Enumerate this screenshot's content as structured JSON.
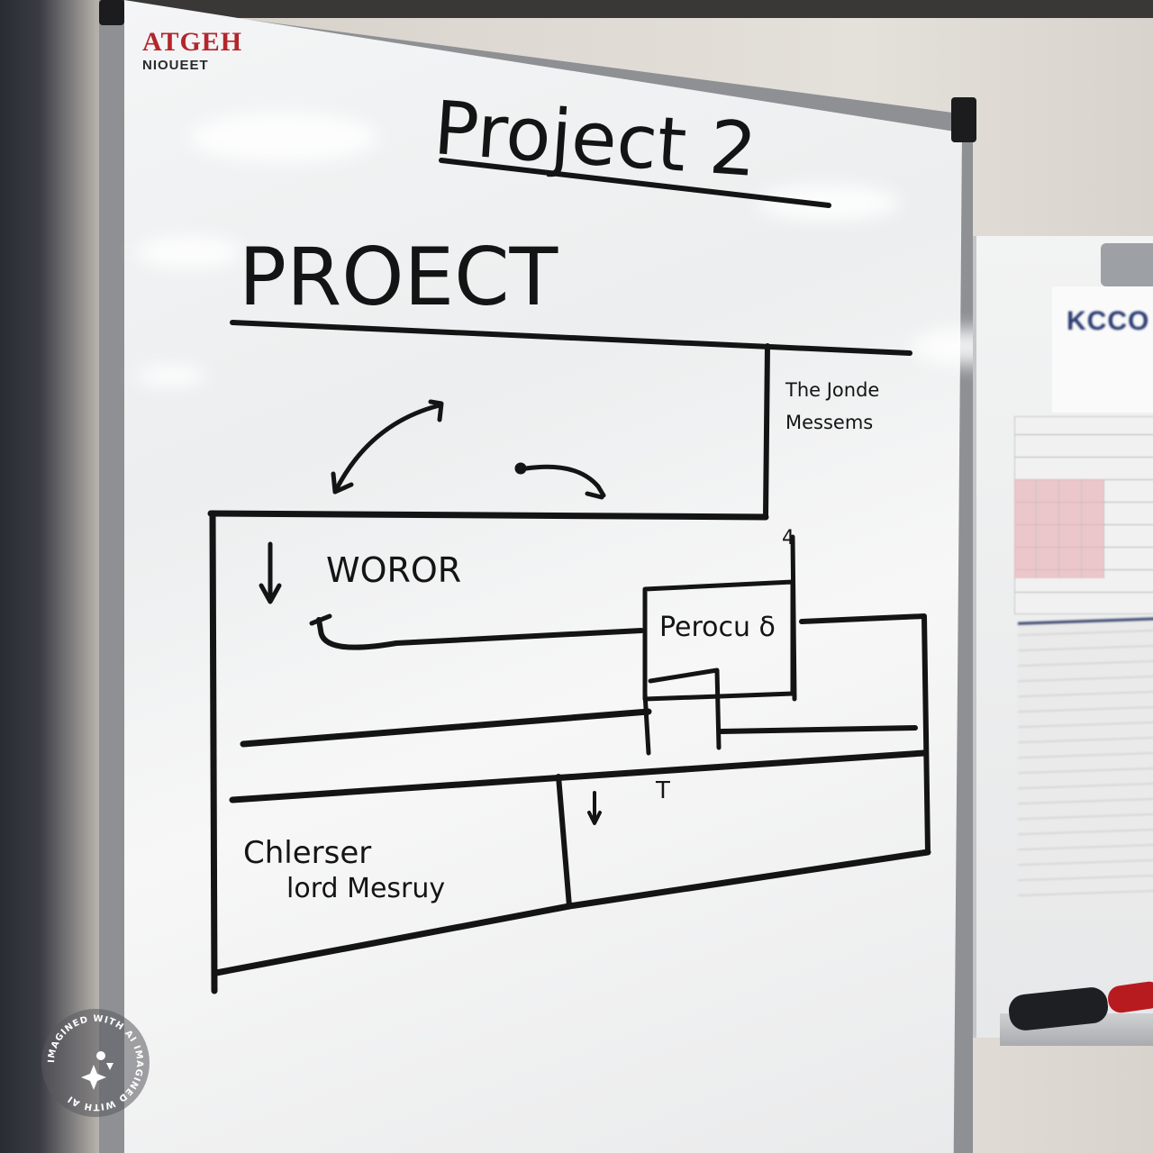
{
  "board_brand": {
    "name": "ATGEH",
    "subtitle": "NIOUEET"
  },
  "heading_main": "Project 2",
  "heading_sub": "PROECT",
  "side_note": {
    "line1": "The Jonde",
    "line2": "Messems"
  },
  "box_labels": {
    "work": "WOROR",
    "process": "Perocu δ",
    "bottom_left_line1": "Chlerser",
    "bottom_left_line2": "lord Mesruy",
    "small_mark": "T",
    "corner_number": "4"
  },
  "side_board": {
    "logo_text": "KCCO"
  },
  "watermark": {
    "text": "IMAGINED WITH AI  IMAGINED WITH AI"
  },
  "colors": {
    "marker_ink": "#141414",
    "brand_red": "#b3262c",
    "side_logo_blue": "#2b3c72"
  }
}
